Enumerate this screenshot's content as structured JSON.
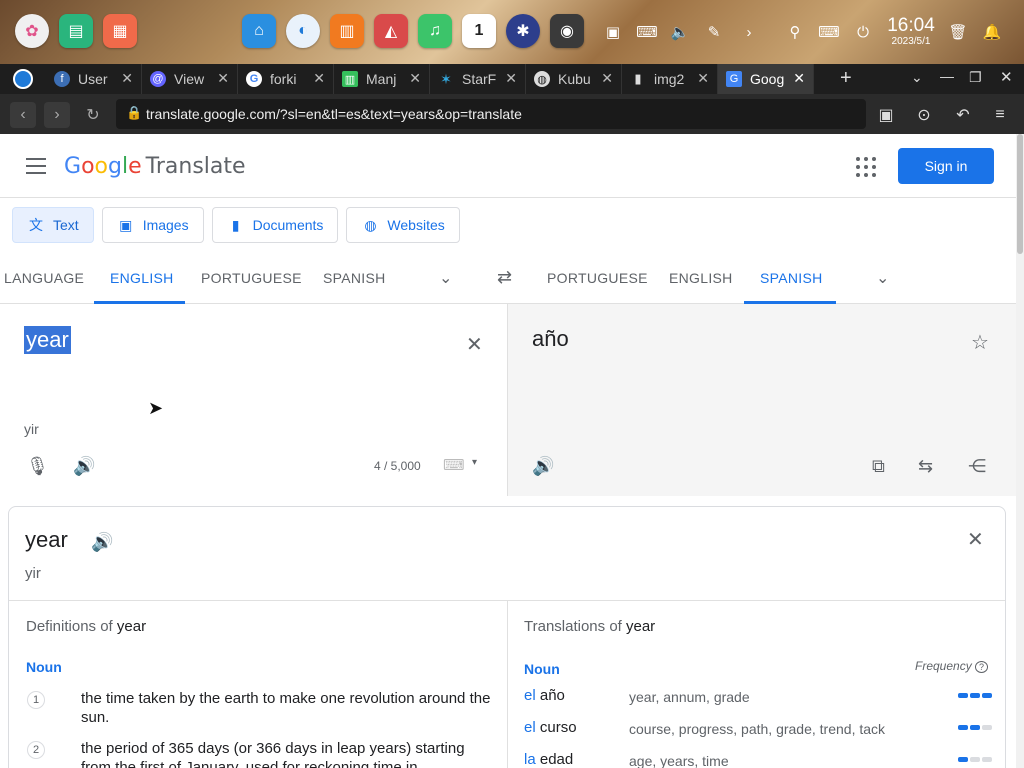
{
  "taskbar": {
    "clock_time": "16:04",
    "clock_date": "2023/5/1",
    "app_icons": [
      "settings-flower-icon",
      "terminal-icon",
      "layout-app-icon",
      "store-icon",
      "browser-icon",
      "package-icon",
      "photos-icon",
      "music-icon",
      "calendar-icon",
      "settings-wheel-icon",
      "disk-icon"
    ],
    "calendar_day": "1"
  },
  "tabs": [
    {
      "title": "User",
      "icon": "fedora-icon"
    },
    {
      "title": "View",
      "icon": "mastodon-icon"
    },
    {
      "title": "forki",
      "icon": "google-icon"
    },
    {
      "title": "Manj",
      "icon": "manjaro-icon"
    },
    {
      "title": "StarF",
      "icon": "star-icon"
    },
    {
      "title": "Kubu",
      "icon": "github-icon"
    },
    {
      "title": "img2",
      "icon": "archive-icon"
    },
    {
      "title": "Goog",
      "icon": "translate-icon"
    }
  ],
  "url": "translate.google.com/?sl=en&tl=es&text=years&op=translate",
  "header": {
    "logo_google": "Google",
    "logo_translate": "Translate",
    "signin": "Sign in"
  },
  "modes": [
    {
      "label": "Text",
      "icon": "text-icon"
    },
    {
      "label": "Images",
      "icon": "image-icon"
    },
    {
      "label": "Documents",
      "icon": "document-icon"
    },
    {
      "label": "Websites",
      "icon": "globe-icon"
    }
  ],
  "source_langs": [
    "LANGUAGE",
    "ENGLISH",
    "PORTUGUESE",
    "SPANISH"
  ],
  "target_langs": [
    "PORTUGUESE",
    "ENGLISH",
    "SPANISH"
  ],
  "source": {
    "text": "year",
    "pronunciation": "yir",
    "counter": "4 / 5,000"
  },
  "target": {
    "text": "año"
  },
  "dictionary": {
    "word": "year",
    "pronunciation": "yir",
    "definitions_title": "Definitions of",
    "translations_title": "Translations of",
    "pos": "Noun",
    "frequency_label": "Frequency",
    "definitions": [
      {
        "num": "1",
        "text": "the time taken by the earth to make one revolution around the sun."
      },
      {
        "num": "2",
        "text": "the period of 365 days (or 366 days in leap years) starting from the first of January, used for reckoning time in"
      }
    ],
    "translations": [
      {
        "article": "el",
        "word": "año",
        "synonyms": "year, annum, grade",
        "frequency": 3
      },
      {
        "article": "el",
        "word": "curso",
        "synonyms": "course, progress, path, grade, trend, tack",
        "frequency": 2
      },
      {
        "article": "la",
        "word": "edad",
        "synonyms": "age, years, time",
        "frequency": 1
      }
    ]
  }
}
